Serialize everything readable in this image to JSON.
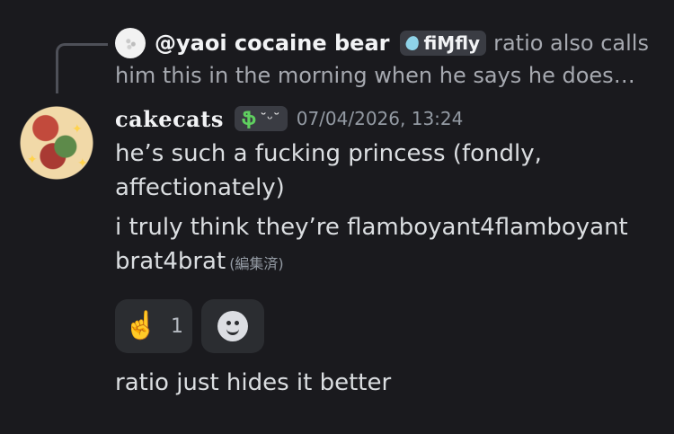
{
  "reply": {
    "username": "@yaoi cocaine bear",
    "tag_label": "fiⱮfly",
    "snippet": "ratio also calls him this in the morning when he says he doesnt",
    "snippet_line1": "ratio also calls",
    "snippet_line2": "him this in the morning when he says he doesnt …"
  },
  "message": {
    "username": "cakecats",
    "tag_icon": "ֆ",
    "tag_face": "˘ᵕ˘",
    "timestamp": "07/04/2026, 13:24",
    "lines": [
      "he’s such a fucking princess (fondly, affectionately)",
      "i truly think they’re flamboyant4flamboyant brat4brat"
    ],
    "edited_label": "(編集済)"
  },
  "reactions": [
    {
      "emoji": "☝️",
      "count": "1",
      "icon": "pointing-up-emoji"
    }
  ],
  "add_reaction_icon": "smiley-face-icon",
  "followup": {
    "text": "ratio just hides it better"
  },
  "colors": {
    "background": "#1a1a1e",
    "reaction_bg": "#2b2d31",
    "text": "#dbdee1",
    "muted": "#949ba4"
  }
}
